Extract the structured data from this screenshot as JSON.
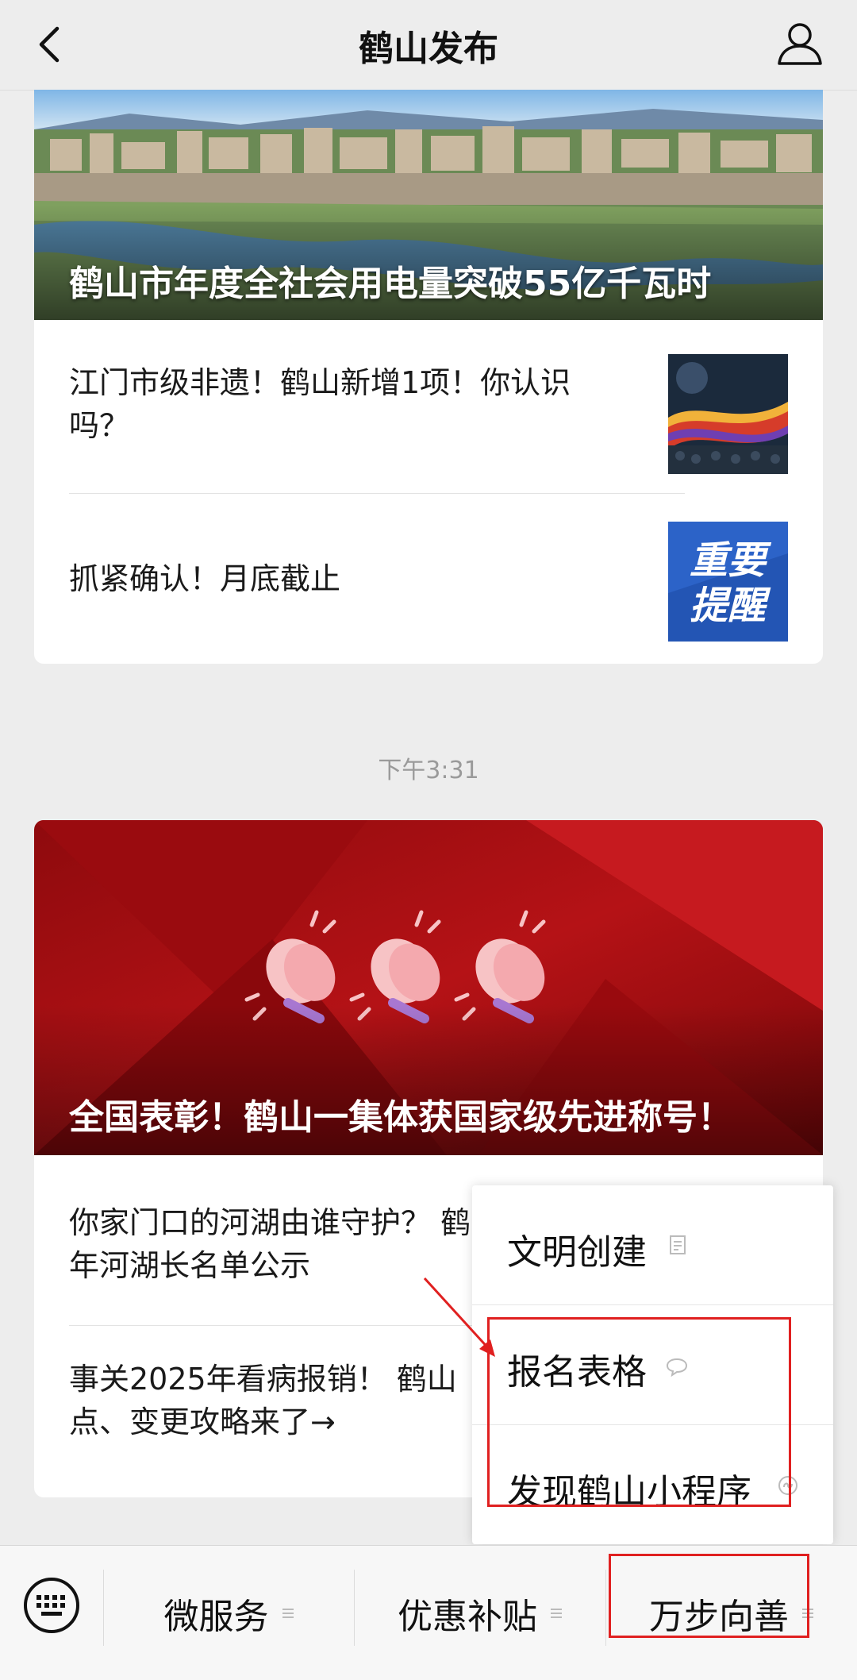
{
  "header": {
    "title": "鹤山发布"
  },
  "card1": {
    "hero_title": "鹤山市年度全社会用电量突破55亿千瓦时",
    "items": [
      {
        "title": "江门市级非遗！鹤山新增1项！你认识吗？"
      },
      {
        "title": "抓紧确认！月底截止"
      }
    ],
    "thumb2_text": [
      "重要",
      "提醒"
    ]
  },
  "timestamp": "下午3:31",
  "card2": {
    "hero_title": "全国表彰！鹤山一集体获国家级先进称号！",
    "items": [
      {
        "title": "你家门口的河湖由谁守护？ 鹤",
        "title2": "年河湖长名单公示"
      },
      {
        "title": "事关2025年看病报销！ 鹤山",
        "title2": "点、变更攻略来了→"
      }
    ]
  },
  "popup": {
    "items": [
      {
        "label": "文明创建",
        "icon": "article-icon"
      },
      {
        "label": "报名表格",
        "icon": "chat-bubble-icon"
      },
      {
        "label": "发现鹤山小程序",
        "icon": "mini-program-icon"
      }
    ]
  },
  "bottom_bar": {
    "items": [
      {
        "label": "微服务"
      },
      {
        "label": "优惠补贴"
      },
      {
        "label": "万步向善"
      }
    ]
  },
  "colors": {
    "annotation": "#e02020",
    "hero2_bg": "#a60d10"
  }
}
